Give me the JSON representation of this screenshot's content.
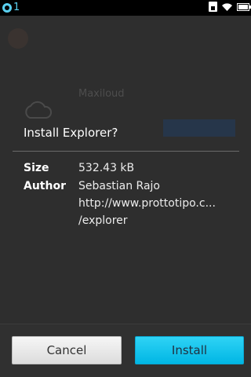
{
  "status_bar": {
    "notification_count": "1",
    "icons": [
      "notification-icon",
      "sim-icon",
      "wifi-icon",
      "battery-icon"
    ]
  },
  "background_app": {
    "title": "Maxiloud"
  },
  "dialog": {
    "title": "Install Explorer?",
    "rows": [
      {
        "label": "Size",
        "value": "532.43 kB"
      },
      {
        "label": "Author",
        "value": "Sebastian Rajo"
      }
    ],
    "url_line1": "http://www.prottotipo.c...",
    "url_line2": "/explorer"
  },
  "actions": {
    "cancel_label": "Cancel",
    "install_label": "Install"
  },
  "colors": {
    "accent": "#00b6e4",
    "status_accent": "#5ad0f0"
  }
}
